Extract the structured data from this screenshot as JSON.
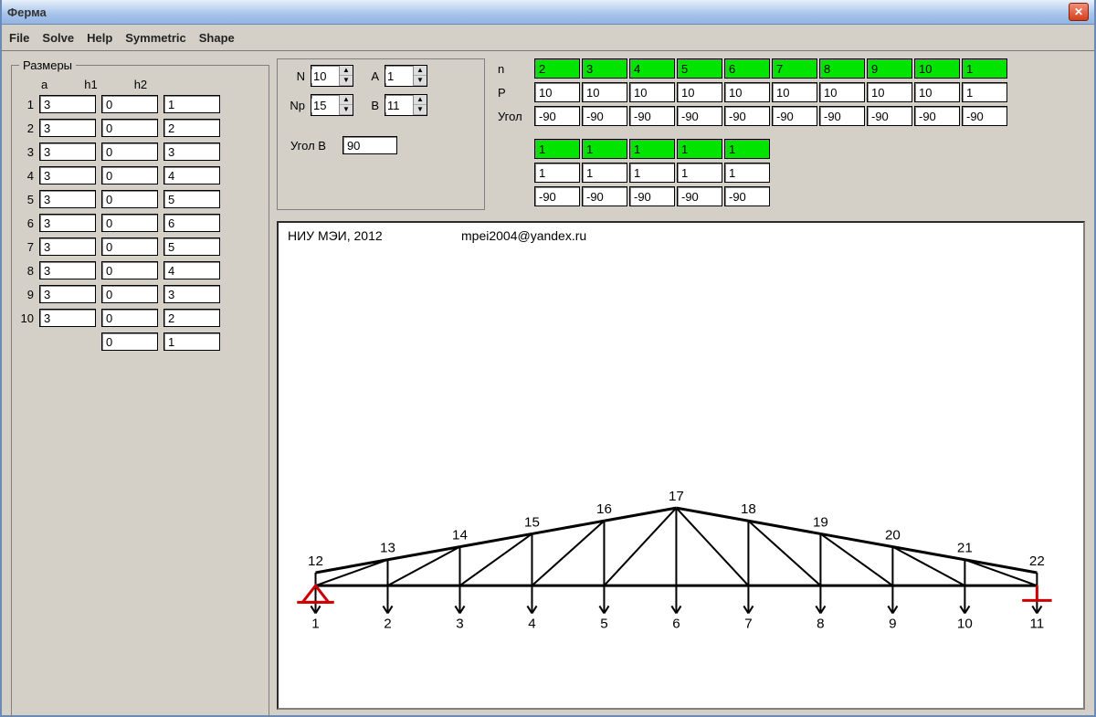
{
  "window": {
    "title": "Ферма"
  },
  "menu": [
    "File",
    "Solve",
    "Help",
    "Symmetric",
    "Shape"
  ],
  "dims": {
    "legend": "Размеры",
    "headers": [
      "a",
      "h1",
      "h2"
    ],
    "rows": [
      {
        "i": "1",
        "a": "3",
        "h1": "0",
        "h2": "1"
      },
      {
        "i": "2",
        "a": "3",
        "h1": "0",
        "h2": "2"
      },
      {
        "i": "3",
        "a": "3",
        "h1": "0",
        "h2": "3"
      },
      {
        "i": "4",
        "a": "3",
        "h1": "0",
        "h2": "4"
      },
      {
        "i": "5",
        "a": "3",
        "h1": "0",
        "h2": "5"
      },
      {
        "i": "6",
        "a": "3",
        "h1": "0",
        "h2": "6"
      },
      {
        "i": "7",
        "a": "3",
        "h1": "0",
        "h2": "5"
      },
      {
        "i": "8",
        "a": "3",
        "h1": "0",
        "h2": "4"
      },
      {
        "i": "9",
        "a": "3",
        "h1": "0",
        "h2": "3"
      },
      {
        "i": "10",
        "a": "3",
        "h1": "0",
        "h2": "2"
      }
    ],
    "extra": {
      "h1": "0",
      "h2": "1"
    }
  },
  "params": {
    "N_label": "N",
    "N": "10",
    "Np_label": "Np",
    "Np": "15",
    "A_label": "A",
    "A": "1",
    "B_label": "B",
    "B": "11",
    "angleB_label": "Угол B",
    "angleB": "90"
  },
  "loads": {
    "n_label": "n",
    "P_label": "P",
    "angle_label": "Угол",
    "n": [
      "2",
      "3",
      "4",
      "5",
      "6",
      "7",
      "8",
      "9",
      "10",
      "1"
    ],
    "P": [
      "10",
      "10",
      "10",
      "10",
      "10",
      "10",
      "10",
      "10",
      "10",
      "1"
    ],
    "ang": [
      "-90",
      "-90",
      "-90",
      "-90",
      "-90",
      "-90",
      "-90",
      "-90",
      "-90",
      "-90"
    ],
    "n2": [
      "1",
      "1",
      "1",
      "1",
      "1"
    ],
    "P2": [
      "1",
      "1",
      "1",
      "1",
      "1"
    ],
    "ang2": [
      "-90",
      "-90",
      "-90",
      "-90",
      "-90"
    ]
  },
  "canvas": {
    "org": "НИУ МЭИ, 2012",
    "email": "mpei2004@yandex.ru",
    "top_labels": [
      "12",
      "13",
      "14",
      "15",
      "16",
      "17",
      "18",
      "19",
      "20",
      "21",
      "22"
    ],
    "bottom_labels": [
      "1",
      "2",
      "3",
      "4",
      "5",
      "6",
      "7",
      "8",
      "9",
      "10",
      "11"
    ]
  }
}
